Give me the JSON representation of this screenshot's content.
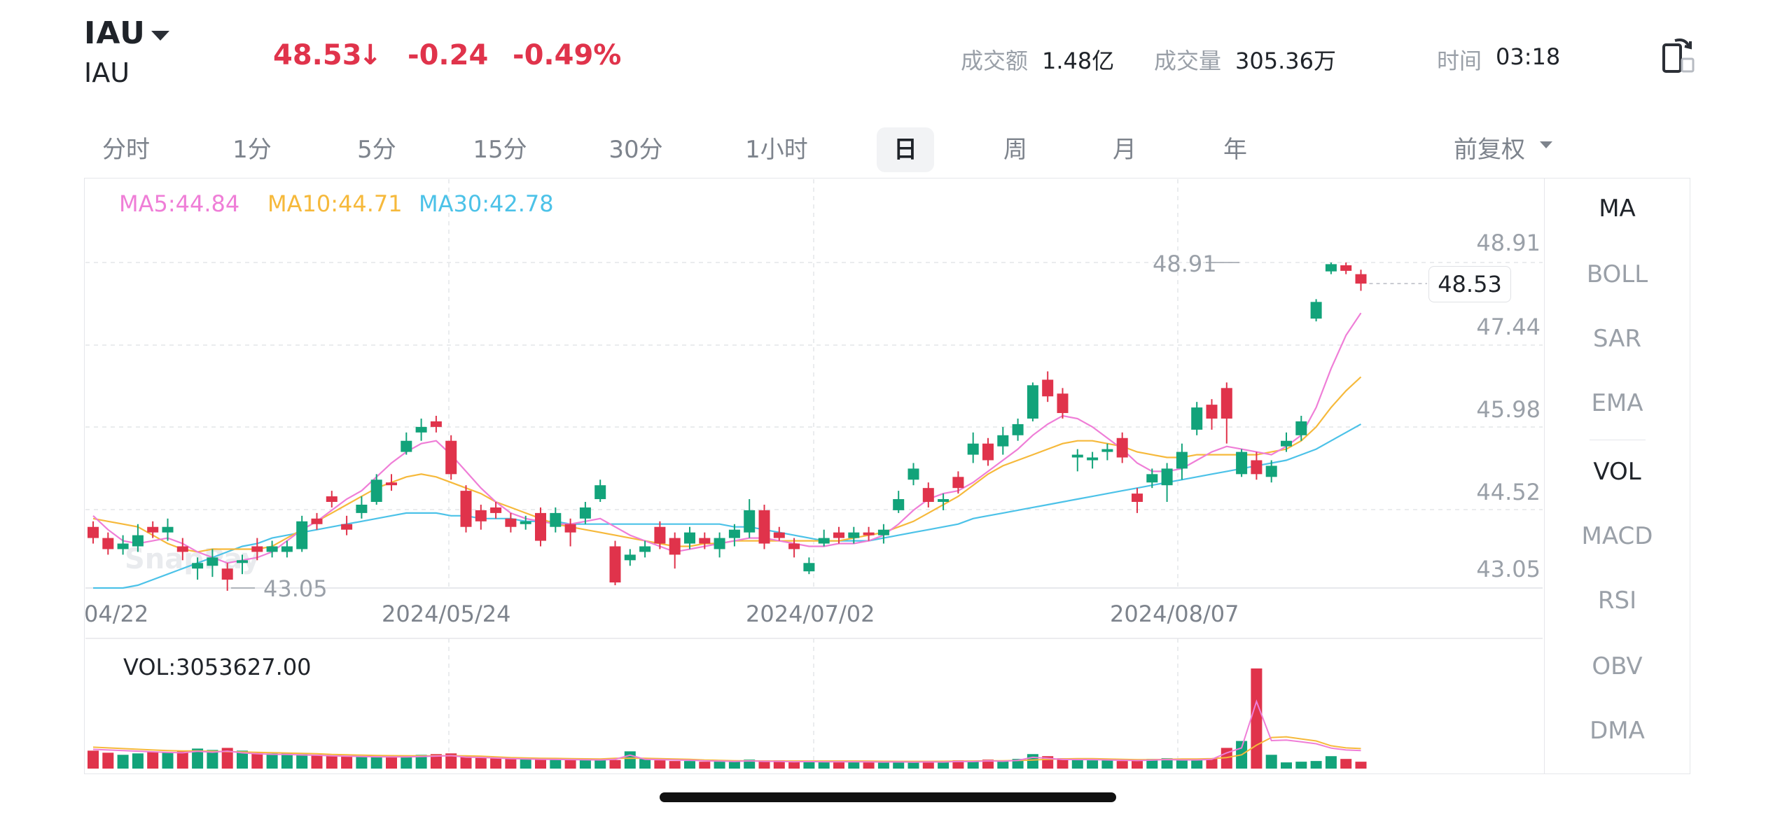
{
  "header": {
    "symbol": "IAU",
    "subtitle": "IAU",
    "price": "48.53",
    "arrow": "↓",
    "change": "-0.24",
    "change_pct": "-0.49%",
    "turnover_label": "成交额",
    "turnover_value": "1.48亿",
    "volume_label": "成交量",
    "volume_value": "305.36万",
    "time_label": "时间",
    "time_value": "03:18",
    "icon": "rotate-screen-icon",
    "colors": {
      "down": "#e0334b",
      "up": "#12a37a"
    }
  },
  "tabs": [
    "分时",
    "1分",
    "5分",
    "15分",
    "30分",
    "1小时",
    "日",
    "周",
    "月",
    "年"
  ],
  "active_tab": "日",
  "adjust_label": "前复权",
  "legend": {
    "ma5": "MA5:44.84",
    "ma10": "MA10:44.71",
    "ma30": "MA30:42.78"
  },
  "legend_colors": {
    "ma5": "#ef7ed7",
    "ma10": "#f6b93b",
    "ma30": "#4cc2e8"
  },
  "indicators": [
    "MA",
    "BOLL",
    "SAR",
    "EMA",
    "VOL",
    "MACD",
    "RSI",
    "OBV",
    "DMA"
  ],
  "active_indicators": [
    "MA",
    "VOL"
  ],
  "volume_label": "VOL:3053627.00",
  "current_price_tag": "48.53",
  "watermark": "SnapPay",
  "chart_data": {
    "type": "candlestick",
    "y_ticks": [
      "48.91",
      "47.44",
      "45.98",
      "44.52",
      "43.05"
    ],
    "ylim": [
      43.05,
      48.91
    ],
    "x_ticks": [
      "04/22",
      "2024/05/24",
      "2024/07/02",
      "2024/08/07"
    ],
    "high_label": "48.91",
    "low_label": "43.05",
    "last_price": 48.53,
    "candles": [
      [
        44.15,
        43.95,
        44.25,
        43.85
      ],
      [
        43.95,
        43.75,
        44.05,
        43.65
      ],
      [
        43.75,
        43.85,
        44.0,
        43.65
      ],
      [
        43.8,
        44.0,
        44.2,
        43.7
      ],
      [
        44.15,
        44.05,
        44.25,
        43.95
      ],
      [
        44.05,
        44.15,
        44.3,
        43.9
      ],
      [
        43.8,
        43.7,
        43.95,
        43.55
      ],
      [
        43.4,
        43.5,
        43.6,
        43.2
      ],
      [
        43.45,
        43.6,
        43.75,
        43.25
      ],
      [
        43.4,
        43.2,
        43.5,
        43.0
      ],
      [
        43.5,
        43.55,
        43.65,
        43.3
      ],
      [
        43.8,
        43.7,
        43.95,
        43.55
      ],
      [
        43.7,
        43.8,
        43.9,
        43.6
      ],
      [
        43.7,
        43.8,
        43.9,
        43.6
      ],
      [
        43.75,
        44.25,
        44.35,
        43.7
      ],
      [
        44.3,
        44.2,
        44.4,
        44.1
      ],
      [
        44.7,
        44.6,
        44.8,
        44.5
      ],
      [
        44.2,
        44.1,
        44.35,
        44.0
      ],
      [
        44.4,
        44.55,
        44.7,
        44.3
      ],
      [
        44.6,
        45.0,
        45.1,
        44.55
      ],
      [
        44.95,
        44.9,
        45.1,
        44.8
      ],
      [
        45.5,
        45.7,
        45.85,
        45.45
      ],
      [
        45.85,
        45.95,
        46.1,
        45.7
      ],
      [
        46.05,
        45.95,
        46.15,
        45.85
      ],
      [
        45.7,
        45.1,
        45.8,
        45.0
      ],
      [
        44.8,
        44.15,
        44.9,
        44.05
      ],
      [
        44.45,
        44.25,
        44.55,
        44.1
      ],
      [
        44.5,
        44.4,
        44.6,
        44.3
      ],
      [
        44.3,
        44.15,
        44.4,
        44.05
      ],
      [
        44.2,
        44.25,
        44.35,
        44.1
      ],
      [
        44.4,
        43.9,
        44.5,
        43.8
      ],
      [
        44.15,
        44.4,
        44.5,
        44.05
      ],
      [
        44.2,
        44.05,
        44.3,
        43.8
      ],
      [
        44.3,
        44.5,
        44.6,
        44.2
      ],
      [
        44.65,
        44.9,
        45.0,
        44.6
      ],
      [
        43.8,
        43.15,
        43.9,
        43.1
      ],
      [
        43.55,
        43.65,
        43.75,
        43.45
      ],
      [
        43.7,
        43.8,
        43.9,
        43.6
      ],
      [
        44.15,
        43.85,
        44.25,
        43.75
      ],
      [
        43.95,
        43.65,
        44.05,
        43.4
      ],
      [
        43.85,
        44.05,
        44.15,
        43.75
      ],
      [
        43.95,
        43.85,
        44.05,
        43.75
      ],
      [
        43.75,
        43.95,
        44.05,
        43.6
      ],
      [
        43.95,
        44.1,
        44.2,
        43.8
      ],
      [
        44.05,
        44.45,
        44.65,
        43.95
      ],
      [
        44.45,
        43.85,
        44.55,
        43.75
      ],
      [
        44.05,
        43.95,
        44.15,
        43.9
      ],
      [
        43.85,
        43.75,
        43.95,
        43.6
      ],
      [
        43.35,
        43.5,
        43.6,
        43.3
      ],
      [
        43.85,
        43.95,
        44.1,
        43.8
      ],
      [
        44.05,
        43.95,
        44.15,
        43.85
      ],
      [
        43.95,
        44.05,
        44.15,
        43.85
      ],
      [
        44.05,
        44.0,
        44.15,
        43.9
      ],
      [
        44.0,
        44.1,
        44.2,
        43.85
      ],
      [
        44.45,
        44.65,
        44.8,
        44.4
      ],
      [
        45.0,
        45.2,
        45.3,
        44.9
      ],
      [
        44.85,
        44.6,
        44.95,
        44.5
      ],
      [
        44.6,
        44.65,
        44.75,
        44.45
      ],
      [
        45.05,
        44.85,
        45.15,
        44.75
      ],
      [
        45.45,
        45.65,
        45.85,
        45.3
      ],
      [
        45.65,
        45.35,
        45.75,
        45.25
      ],
      [
        45.6,
        45.8,
        45.95,
        45.45
      ],
      [
        45.8,
        46.0,
        46.1,
        45.7
      ],
      [
        46.1,
        46.7,
        46.75,
        46.05
      ],
      [
        46.8,
        46.5,
        46.95,
        46.4
      ],
      [
        46.55,
        46.2,
        46.65,
        46.1
      ],
      [
        45.4,
        45.45,
        45.55,
        45.15
      ],
      [
        45.35,
        45.4,
        45.5,
        45.2
      ],
      [
        45.5,
        45.55,
        45.65,
        45.35
      ],
      [
        45.75,
        45.4,
        45.85,
        45.3
      ],
      [
        44.75,
        44.6,
        44.85,
        44.4
      ],
      [
        44.95,
        45.1,
        45.2,
        44.85
      ],
      [
        44.9,
        45.2,
        45.3,
        44.6
      ],
      [
        45.2,
        45.5,
        45.65,
        45.0
      ],
      [
        45.9,
        46.3,
        46.4,
        45.8
      ],
      [
        46.35,
        46.1,
        46.45,
        45.9
      ],
      [
        46.65,
        46.1,
        46.75,
        45.65
      ],
      [
        45.1,
        45.5,
        45.55,
        45.05
      ],
      [
        45.35,
        45.1,
        45.5,
        45.0
      ],
      [
        45.05,
        45.25,
        45.35,
        44.95
      ],
      [
        45.6,
        45.7,
        45.85,
        45.5
      ],
      [
        45.8,
        46.05,
        46.15,
        45.7
      ],
      [
        47.9,
        48.2,
        48.25,
        47.85
      ],
      [
        48.75,
        48.88,
        48.91,
        48.7
      ],
      [
        48.86,
        48.76,
        48.91,
        48.7
      ],
      [
        48.7,
        48.53,
        48.78,
        48.4
      ]
    ],
    "ma5": [
      44.35,
      44.1,
      43.9,
      43.85,
      43.9,
      43.95,
      43.85,
      43.7,
      43.6,
      43.5,
      43.55,
      43.6,
      43.7,
      43.9,
      44.1,
      44.25,
      44.45,
      44.65,
      44.8,
      45.05,
      45.3,
      45.5,
      45.65,
      45.7,
      45.45,
      45.15,
      44.85,
      44.6,
      44.4,
      44.3,
      44.25,
      44.2,
      44.2,
      44.25,
      44.3,
      44.15,
      44.0,
      43.9,
      43.8,
      43.7,
      43.75,
      43.8,
      43.85,
      43.9,
      43.95,
      43.95,
      43.9,
      43.85,
      43.8,
      43.8,
      43.85,
      43.85,
      43.9,
      44.0,
      44.2,
      44.45,
      44.65,
      44.75,
      44.8,
      44.95,
      45.15,
      45.35,
      45.55,
      45.8,
      46.0,
      46.15,
      46.1,
      45.95,
      45.75,
      45.55,
      45.3,
      45.15,
      45.15,
      45.2,
      45.35,
      45.5,
      45.6,
      45.55,
      45.5,
      45.45,
      45.6,
      45.8,
      46.3,
      47.0,
      47.6,
      48.0
    ],
    "ma10": [
      44.3,
      44.25,
      44.2,
      44.15,
      44.0,
      43.85,
      43.75,
      43.7,
      43.75,
      43.75,
      43.75,
      43.75,
      43.8,
      43.95,
      44.1,
      44.25,
      44.4,
      44.55,
      44.7,
      44.85,
      44.95,
      45.05,
      45.1,
      45.05,
      44.95,
      44.85,
      44.75,
      44.6,
      44.5,
      44.4,
      44.3,
      44.2,
      44.15,
      44.1,
      44.05,
      44.0,
      43.95,
      43.9,
      43.85,
      43.8,
      43.8,
      43.85,
      43.85,
      43.9,
      43.9,
      43.9,
      43.9,
      43.9,
      43.9,
      43.9,
      43.9,
      43.95,
      44.0,
      44.05,
      44.15,
      44.25,
      44.4,
      44.55,
      44.7,
      44.9,
      45.1,
      45.25,
      45.35,
      45.45,
      45.55,
      45.65,
      45.7,
      45.7,
      45.65,
      45.6,
      45.5,
      45.45,
      45.4,
      45.4,
      45.45,
      45.45,
      45.45,
      45.45,
      45.45,
      45.5,
      45.55,
      45.7,
      45.95,
      46.3,
      46.6,
      46.85
    ],
    "ma30": [
      43.05,
      43.05,
      43.05,
      43.1,
      43.2,
      43.3,
      43.4,
      43.5,
      43.6,
      43.7,
      43.8,
      43.85,
      43.95,
      44.0,
      44.05,
      44.1,
      44.15,
      44.2,
      44.25,
      44.3,
      44.35,
      44.4,
      44.4,
      44.4,
      44.35,
      44.35,
      44.3,
      44.3,
      44.3,
      44.25,
      44.25,
      44.25,
      44.2,
      44.2,
      44.2,
      44.2,
      44.2,
      44.2,
      44.2,
      44.2,
      44.2,
      44.2,
      44.2,
      44.15,
      44.15,
      44.1,
      44.05,
      44.0,
      43.95,
      43.9,
      43.9,
      43.9,
      43.9,
      43.95,
      44.0,
      44.05,
      44.1,
      44.15,
      44.2,
      44.3,
      44.35,
      44.4,
      44.45,
      44.5,
      44.55,
      44.6,
      44.65,
      44.7,
      44.75,
      44.8,
      44.85,
      44.9,
      44.95,
      45.0,
      45.05,
      45.1,
      45.15,
      45.2,
      45.25,
      45.3,
      45.35,
      45.45,
      45.55,
      45.7,
      45.85,
      46.0
    ],
    "volume_ylim": [
      0,
      1500
    ],
    "volumes": [
      260,
      230,
      200,
      220,
      240,
      230,
      250,
      290,
      270,
      300,
      260,
      240,
      220,
      230,
      210,
      200,
      190,
      180,
      180,
      170,
      180,
      190,
      200,
      210,
      220,
      180,
      170,
      160,
      150,
      150,
      150,
      145,
      140,
      135,
      130,
      125,
      250,
      140,
      120,
      110,
      110,
      100,
      110,
      100,
      130,
      120,
      120,
      110,
      115,
      105,
      100,
      105,
      100,
      100,
      110,
      105,
      110,
      100,
      120,
      115,
      130,
      120,
      140,
      210,
      180,
      150,
      130,
      120,
      120,
      110,
      130,
      140,
      150,
      130,
      140,
      150,
      300,
      400,
      1450,
      200,
      90,
      100,
      110,
      180,
      140,
      100
    ],
    "vol_ma": [
      310,
      300,
      290,
      280,
      270,
      260,
      255,
      255,
      250,
      245,
      240,
      235,
      230,
      225,
      220,
      215,
      205,
      200,
      195,
      190,
      188,
      186,
      185,
      185,
      186,
      185,
      180,
      170,
      160,
      155,
      150,
      148,
      145,
      142,
      140,
      150,
      150,
      150,
      145,
      140,
      135,
      125,
      120,
      115,
      112,
      110,
      110,
      110,
      110,
      110,
      110,
      110,
      108,
      106,
      105,
      105,
      105,
      106,
      108,
      110,
      112,
      115,
      118,
      125,
      135,
      140,
      145,
      145,
      140,
      135,
      130,
      130,
      135,
      140,
      140,
      145,
      160,
      200,
      340,
      450,
      460,
      430,
      400,
      330,
      300,
      290
    ]
  }
}
